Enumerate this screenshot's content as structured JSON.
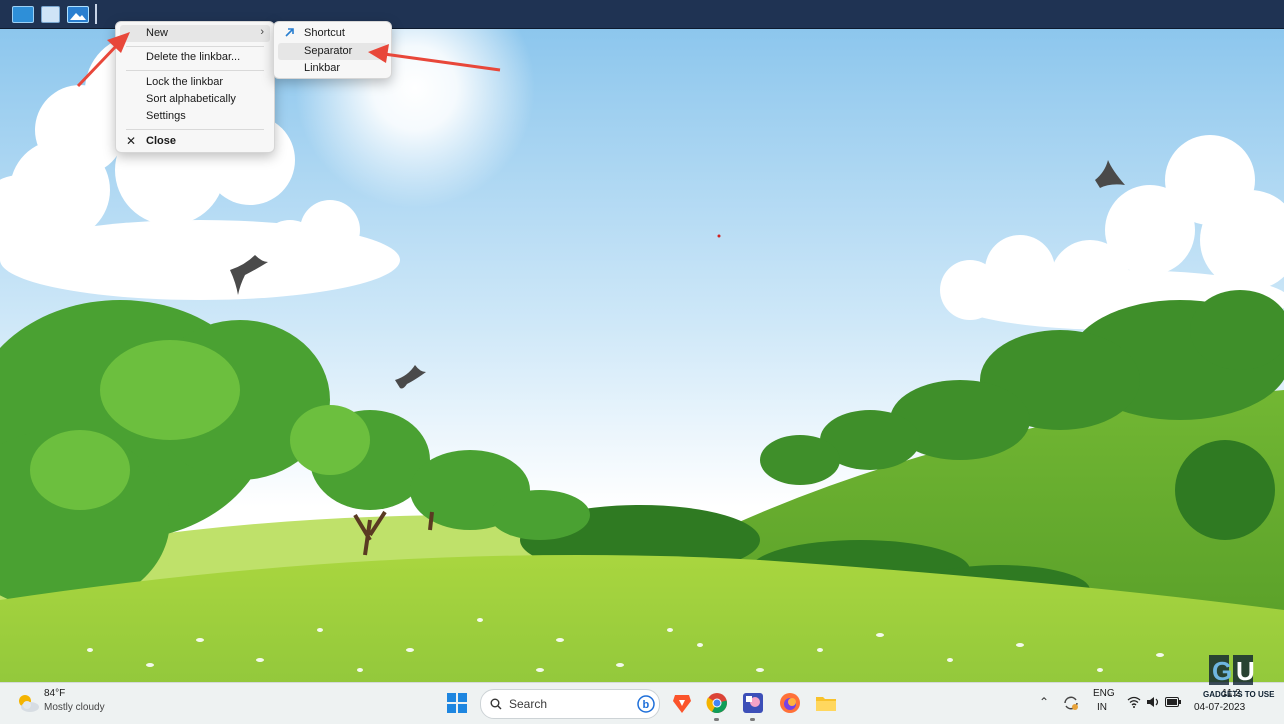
{
  "linkbar": {
    "icons": [
      "desktop-icon",
      "window-icon",
      "picture-icon"
    ]
  },
  "context_menu": {
    "items": [
      {
        "label": "New",
        "has_submenu": true
      },
      {
        "label": "Delete the linkbar..."
      },
      {
        "label": "Lock the linkbar"
      },
      {
        "label": "Sort alphabetically"
      },
      {
        "label": "Settings"
      },
      {
        "label": "Close",
        "icon": "close-icon"
      }
    ]
  },
  "submenu": {
    "items": [
      {
        "label": "Shortcut",
        "icon": "shortcut-arrow-icon"
      },
      {
        "label": "Separator"
      },
      {
        "label": "Linkbar"
      }
    ]
  },
  "taskbar": {
    "weather": {
      "temp": "84°F",
      "desc": "Mostly cloudy",
      "icon": "partly-cloudy-icon"
    },
    "search_label": "Search",
    "apps": [
      "start-icon",
      "bing-icon",
      "brave-icon",
      "chrome-icon",
      "photos-app-icon",
      "firefox-icon",
      "file-explorer-icon"
    ],
    "tray": {
      "lang_line1": "ENG",
      "lang_line2": "IN",
      "time": "11:2",
      "date": "04-07-2023"
    }
  },
  "watermark": {
    "text": "GADGETS TO USE"
  },
  "colors": {
    "linkbar_bg": "#1f3353",
    "taskbar_bg": "#eef2f2",
    "annotation_arrow": "#e8473a",
    "sky_top": "#8ec8ee",
    "grass": "#9ccc3b"
  }
}
